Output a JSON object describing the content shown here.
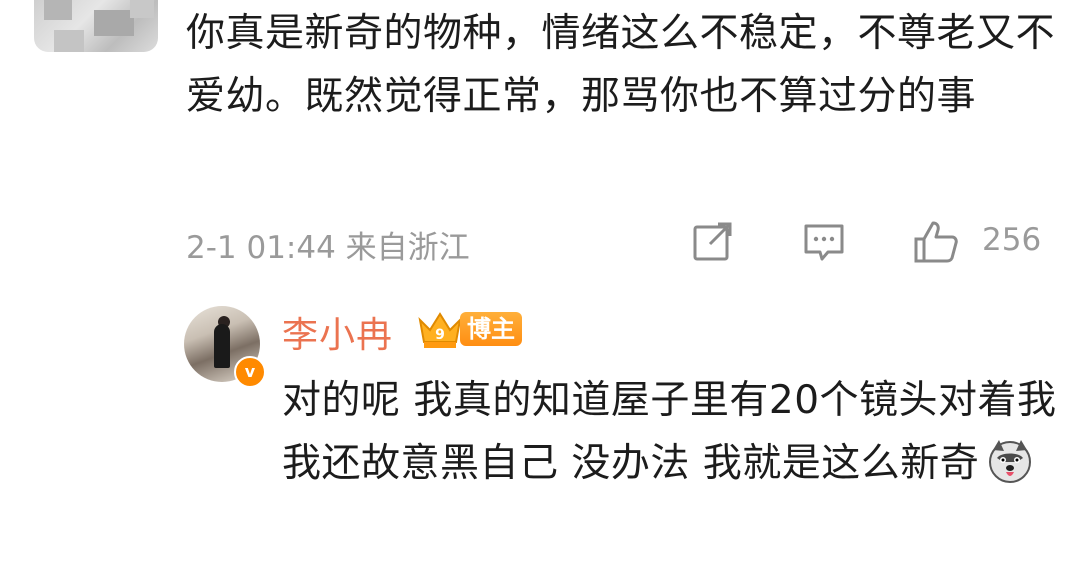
{
  "comment": {
    "text": "你真是新奇的物种，情绪这么不稳定，不尊老又不爱幼。既然觉得正常，那骂你也不算过分的事",
    "timestamp": "2-1 01:44 来自浙江",
    "like_count": "256",
    "icons": [
      "share-icon",
      "comment-icon",
      "like-icon"
    ]
  },
  "reply": {
    "author": "李小冉",
    "badge": "博主",
    "crown_level": "9",
    "verified_mark": "v",
    "text": "对的呢 我真的知道屋子里有20个镜头对着我 我还故意黑自己 没办法 我就是这么新奇",
    "emoji": "husky-emoji"
  },
  "colors": {
    "author_name": "#eb7350",
    "badge_bg": "#ff9a1f",
    "meta_gray": "#9a9a9a"
  }
}
